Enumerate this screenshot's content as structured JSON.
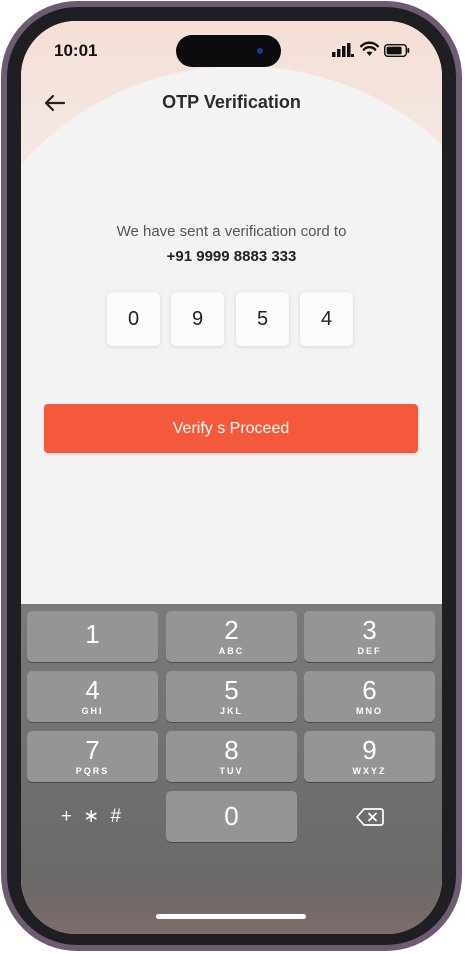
{
  "status_bar": {
    "time": "10:01",
    "icons": [
      "signal-icon",
      "wifi-icon",
      "battery-icon"
    ]
  },
  "header": {
    "back_icon": "arrow-left-icon",
    "title": "OTP Verification"
  },
  "message": {
    "line1": "We have sent a verification cord to",
    "phone": "+91 9999 8883 333"
  },
  "otp": {
    "digits": [
      "0",
      "9",
      "5",
      "4"
    ]
  },
  "verify_button": {
    "label": "Verify s Proceed",
    "color": "#f5593b"
  },
  "keypad": {
    "keys": [
      {
        "digit": "1",
        "letters": ""
      },
      {
        "digit": "2",
        "letters": "ABC"
      },
      {
        "digit": "3",
        "letters": "DEF"
      },
      {
        "digit": "4",
        "letters": "GHI"
      },
      {
        "digit": "5",
        "letters": "JKL"
      },
      {
        "digit": "6",
        "letters": "MNO"
      },
      {
        "digit": "7",
        "letters": "PQRS"
      },
      {
        "digit": "8",
        "letters": "TUV"
      },
      {
        "digit": "9",
        "letters": "WXYZ"
      }
    ],
    "symbols": "+ ∗ #",
    "zero": "0",
    "delete_icon": "backspace-icon"
  }
}
